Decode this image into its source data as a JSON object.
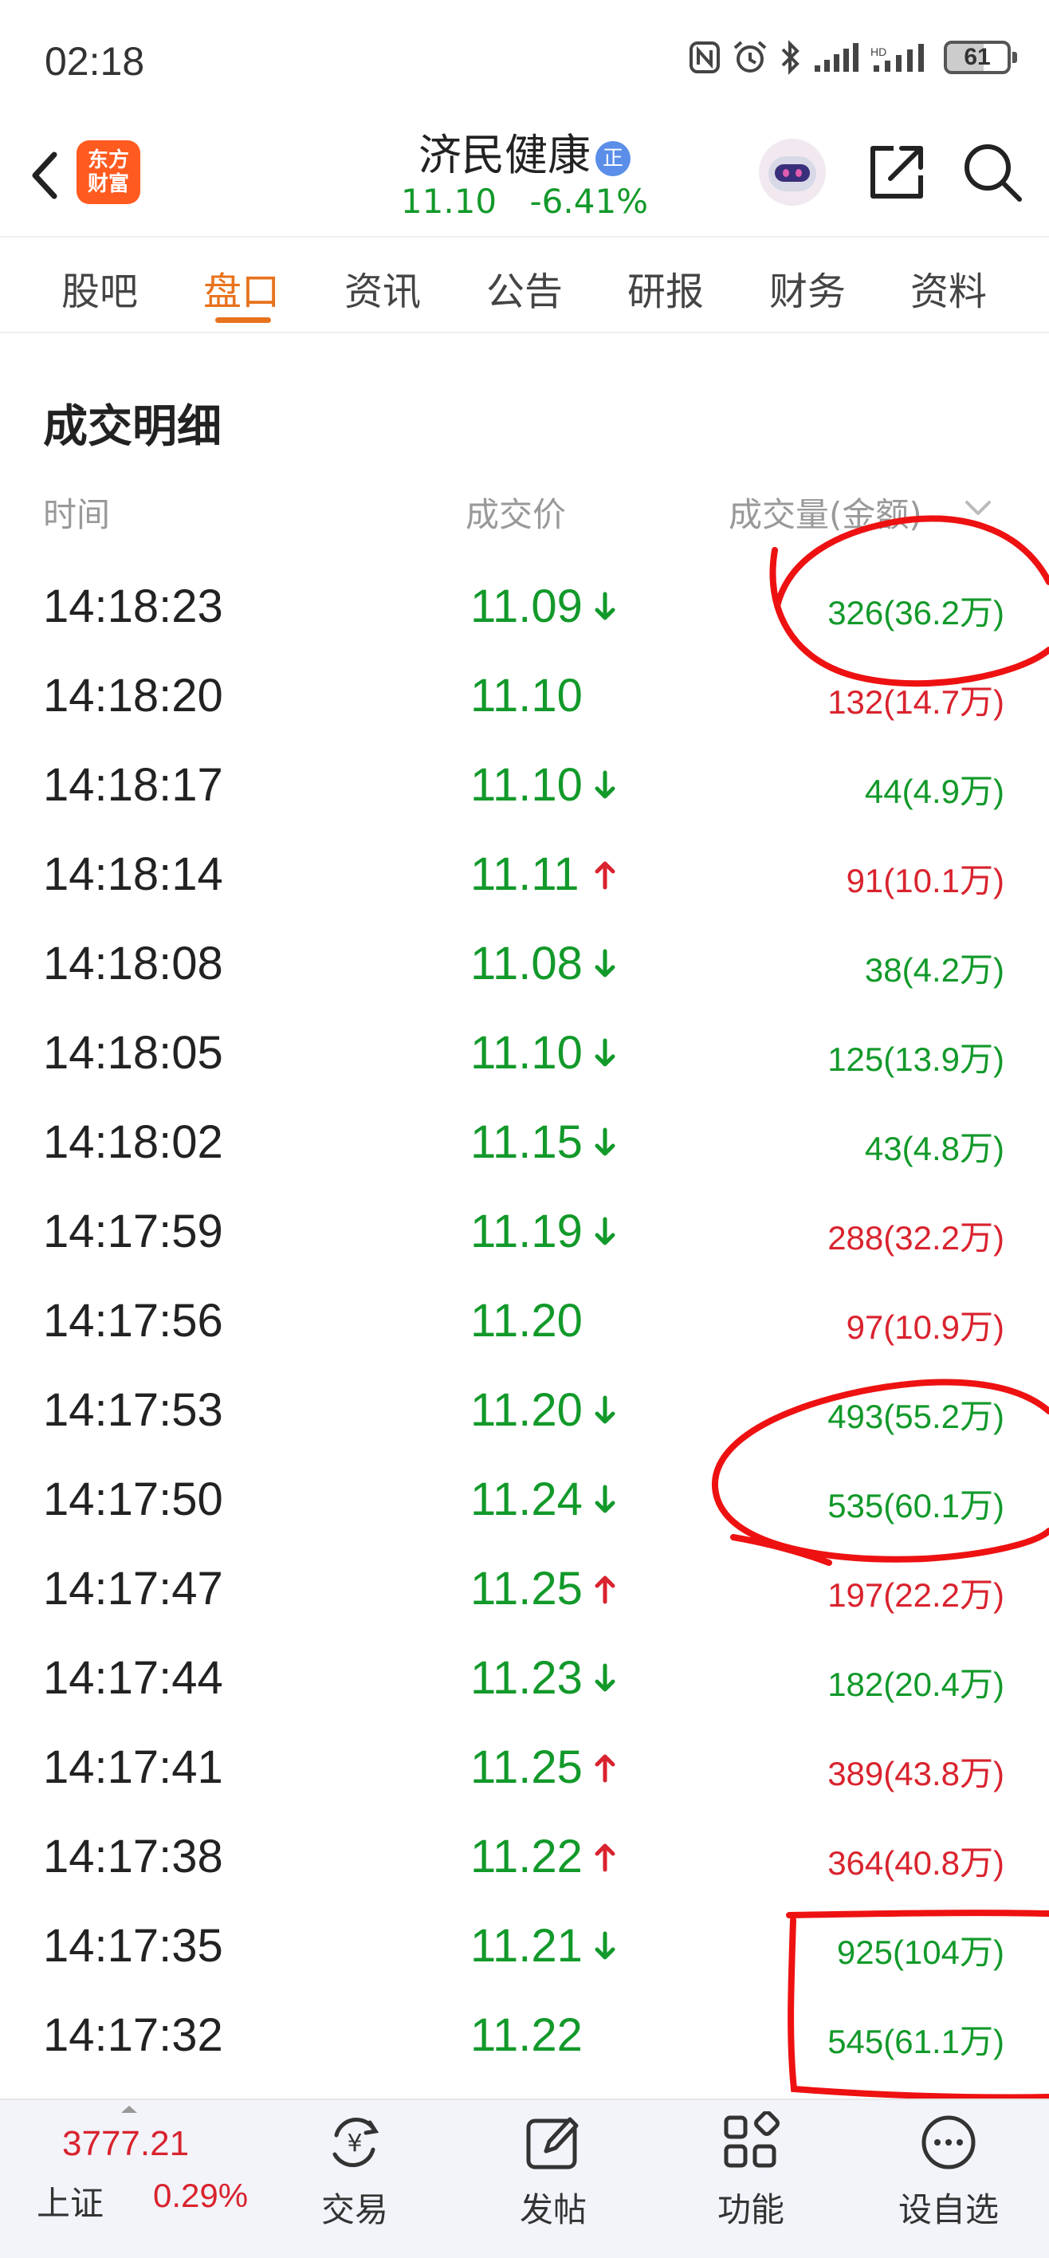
{
  "status_bar": {
    "time": "02:18",
    "battery": "61"
  },
  "header": {
    "logo_line1": "东方",
    "logo_line2": "财富",
    "stock_name": "济民健康",
    "badge": "正",
    "price": "11.10",
    "change_pct": "-6.41%"
  },
  "tabs": [
    {
      "label": "股吧"
    },
    {
      "label": "盘口",
      "active": true
    },
    {
      "label": "资讯"
    },
    {
      "label": "公告"
    },
    {
      "label": "研报"
    },
    {
      "label": "财务"
    },
    {
      "label": "资料"
    }
  ],
  "section": {
    "title": "成交明细",
    "col_time": "时间",
    "col_price": "成交价",
    "col_volume": "成交量(金额)"
  },
  "colors": {
    "up": "#d9232e",
    "down": "#12992a",
    "accent": "#e8731e",
    "annotation": "#ee1111"
  },
  "trades": [
    {
      "time": "14:18:23",
      "price": "11.09",
      "arrow": "down",
      "volume": "326(36.2万)",
      "vol_color": "down"
    },
    {
      "time": "14:18:20",
      "price": "11.10",
      "arrow": "none",
      "volume": "132(14.7万)",
      "vol_color": "up"
    },
    {
      "time": "14:18:17",
      "price": "11.10",
      "arrow": "down",
      "volume": "44(4.9万)",
      "vol_color": "down"
    },
    {
      "time": "14:18:14",
      "price": "11.11",
      "arrow": "up",
      "volume": "91(10.1万)",
      "vol_color": "up"
    },
    {
      "time": "14:18:08",
      "price": "11.08",
      "arrow": "down",
      "volume": "38(4.2万)",
      "vol_color": "down"
    },
    {
      "time": "14:18:05",
      "price": "11.10",
      "arrow": "down",
      "volume": "125(13.9万)",
      "vol_color": "down"
    },
    {
      "time": "14:18:02",
      "price": "11.15",
      "arrow": "down",
      "volume": "43(4.8万)",
      "vol_color": "down"
    },
    {
      "time": "14:17:59",
      "price": "11.19",
      "arrow": "down",
      "volume": "288(32.2万)",
      "vol_color": "up"
    },
    {
      "time": "14:17:56",
      "price": "11.20",
      "arrow": "none",
      "volume": "97(10.9万)",
      "vol_color": "up"
    },
    {
      "time": "14:17:53",
      "price": "11.20",
      "arrow": "down",
      "volume": "493(55.2万)",
      "vol_color": "down"
    },
    {
      "time": "14:17:50",
      "price": "11.24",
      "arrow": "down",
      "volume": "535(60.1万)",
      "vol_color": "down"
    },
    {
      "time": "14:17:47",
      "price": "11.25",
      "arrow": "up",
      "volume": "197(22.2万)",
      "vol_color": "up"
    },
    {
      "time": "14:17:44",
      "price": "11.23",
      "arrow": "down",
      "volume": "182(20.4万)",
      "vol_color": "down"
    },
    {
      "time": "14:17:41",
      "price": "11.25",
      "arrow": "up",
      "volume": "389(43.8万)",
      "vol_color": "up"
    },
    {
      "time": "14:17:38",
      "price": "11.22",
      "arrow": "up",
      "volume": "364(40.8万)",
      "vol_color": "up"
    },
    {
      "time": "14:17:35",
      "price": "11.21",
      "arrow": "down",
      "volume": "925(104万)",
      "vol_color": "down"
    },
    {
      "time": "14:17:32",
      "price": "11.22",
      "arrow": "none",
      "volume": "545(61.1万)",
      "vol_color": "down"
    }
  ],
  "bottom_nav": {
    "index_value": "3777.21",
    "index_name": "上证",
    "index_change": "0.29%",
    "items": [
      {
        "label": "交易",
        "icon": "trade-icon"
      },
      {
        "label": "发帖",
        "icon": "post-icon"
      },
      {
        "label": "功能",
        "icon": "grid-icon"
      },
      {
        "label": "设自选",
        "icon": "more-icon"
      }
    ]
  }
}
